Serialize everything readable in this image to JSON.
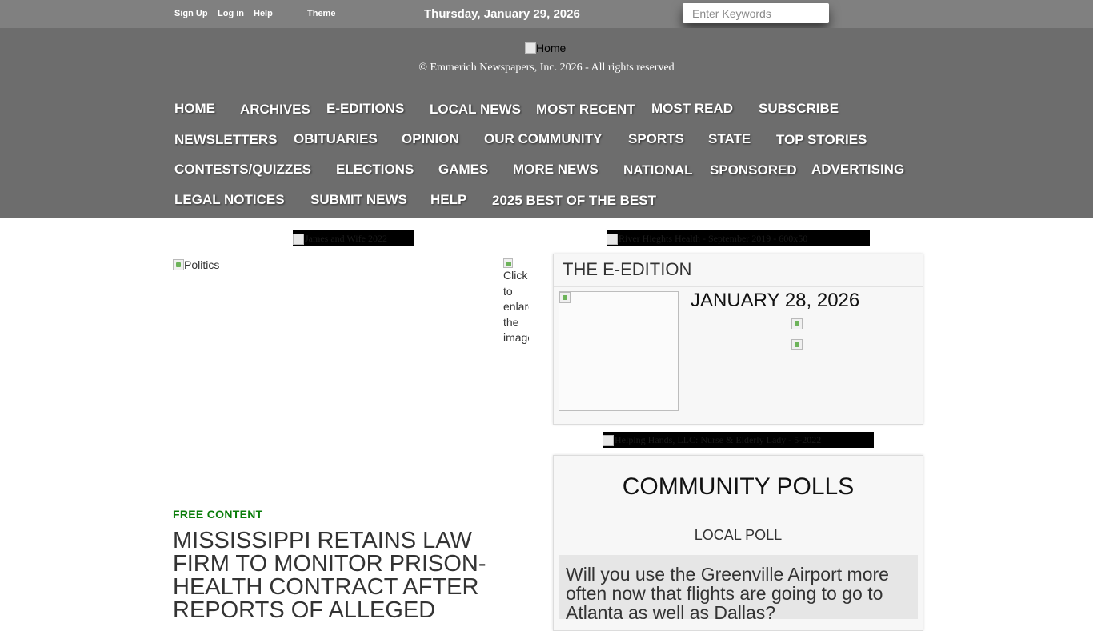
{
  "topbar": {
    "links": [
      "Sign Up",
      "Log in",
      "Help",
      "Theme"
    ],
    "date": "Thursday, January 29, 2026",
    "search_placeholder": "Enter Keywords"
  },
  "masthead": {
    "logo_alt": "Home",
    "copyright": "© Emmerich Newspapers, Inc. 2026 - All rights reserved"
  },
  "nav": {
    "items": [
      "HOME",
      "ARCHIVES",
      "E-EDITIONS",
      "LOCAL NEWS",
      "MOST RECENT",
      "MOST READ",
      "SUBSCRIBE",
      "NEWSLETTERS",
      "OBITUARIES",
      "OPINION",
      "OUR COMMUNITY",
      "SPORTS",
      "STATE",
      "TOP STORIES",
      "CONTESTS/QUIZZES",
      "ELECTIONS",
      "GAMES",
      "MORE NEWS",
      "NATIONAL",
      "SPONSORED",
      "ADVERTISING",
      "LEGAL NOTICES",
      "SUBMIT NEWS",
      "HELP",
      "2025 BEST OF THE BEST"
    ]
  },
  "ads": {
    "left_top": "James and Wife 2022",
    "right_top": "River Hieghts Health - September 2019 - 600x50",
    "right_mid": "Helping Hands, LLC: Nurse & Elderly Lady - 5-2022"
  },
  "article": {
    "image_alt": "Politics",
    "enlarge_text": "Click to enlarge the image",
    "label": "FREE CONTENT",
    "headline": "Mississippi retains law firm to monitor prison-health contract after reports of alleged"
  },
  "eedition": {
    "title": "THE E-EDITION",
    "date": "JANUARY 28, 2026"
  },
  "polls": {
    "title": "COMMUNITY POLLS",
    "subtitle": "LOCAL POLL",
    "question": "Will you use the Greenville Airport more often now that flights are going to go to Atlanta as well as Dallas?"
  }
}
